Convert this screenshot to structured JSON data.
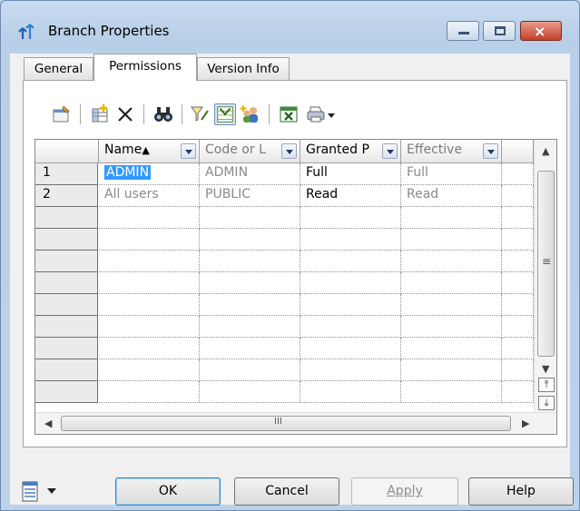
{
  "window": {
    "title": "Branch Properties"
  },
  "title_buttons": {
    "minimize": "minimize-icon",
    "maximize": "maximize-icon",
    "close": "close-icon",
    "close_glyph": "×"
  },
  "tabs": [
    {
      "label": "General",
      "active": false
    },
    {
      "label": "Permissions",
      "active": true
    },
    {
      "label": "Version Info",
      "active": false
    }
  ],
  "toolbar": {
    "icons": [
      "properties-icon",
      "add-rows-icon",
      "delete-icon",
      "find-icon",
      "filter-icon",
      "column-filter-icon",
      "add-users-icon",
      "excel-export-icon",
      "print-icon",
      "dropdown-arrow-icon"
    ]
  },
  "grid": {
    "columns": [
      "Name",
      "Code or L",
      "Granted P",
      "Effective"
    ],
    "sort_indicator": "▲",
    "rows": [
      {
        "num": "1",
        "name": "ADMIN",
        "code": "ADMIN",
        "granted": "Full",
        "effective": "Full"
      },
      {
        "num": "2",
        "name": "All users",
        "code": "PUBLIC",
        "granted": "Read",
        "effective": "Read"
      }
    ],
    "scrollbar_grip": "≡",
    "hscroll_grip": "III"
  },
  "footer": {
    "tool_icon": "grid-tools-icon",
    "ok": "OK",
    "cancel": "Cancel",
    "apply": "Apply",
    "help": "Help"
  },
  "colors": {
    "selection": "#3399ff",
    "close_button": "#c1412d",
    "window_frame": "#bcd1ea"
  }
}
